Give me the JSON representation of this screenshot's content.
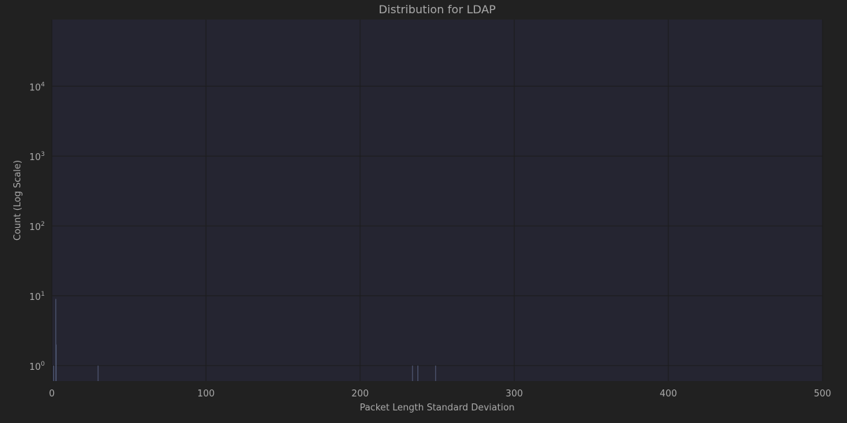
{
  "colors": {
    "background": "#212121",
    "plot_background": "#252531",
    "grid": "#1c1c1c",
    "text": "#a9a9a9",
    "bar_stroke": "#56607e"
  },
  "chart_data": {
    "type": "bar",
    "title": "Distribution for LDAP",
    "xlabel": "Packet Length Standard Deviation",
    "ylabel": "Count (Log Scale)",
    "xlim": [
      0,
      500
    ],
    "ylim": [
      0.6,
      90000
    ],
    "yscale": "log",
    "grid": true,
    "x_ticks": [
      0,
      100,
      200,
      300,
      400,
      500
    ],
    "y_ticks": [
      {
        "value": 1,
        "base": "10",
        "exp": "0"
      },
      {
        "value": 10,
        "base": "10",
        "exp": "1"
      },
      {
        "value": 100,
        "base": "10",
        "exp": "2"
      },
      {
        "value": 1000,
        "base": "10",
        "exp": "3"
      },
      {
        "value": 10000,
        "base": "10",
        "exp": "4"
      }
    ],
    "bars": [
      {
        "x": 1.2,
        "value": 1
      },
      {
        "x": 2.6,
        "value": 9
      },
      {
        "x": 2.8,
        "value": 2
      },
      {
        "x": 30.0,
        "value": 1
      },
      {
        "x": 234.0,
        "value": 1
      },
      {
        "x": 237.5,
        "value": 1
      },
      {
        "x": 249.0,
        "value": 1
      }
    ]
  }
}
